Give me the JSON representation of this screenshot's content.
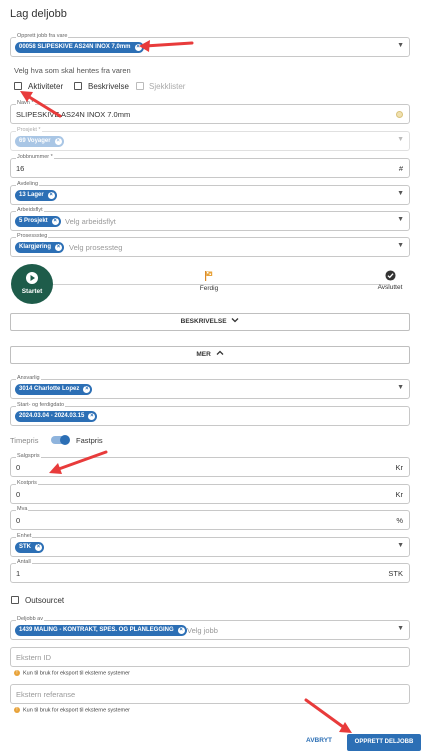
{
  "dialog": {
    "title": "Lag deljobb"
  },
  "source_product": {
    "label": "Opprett jobb fra vare",
    "chip": "00058 SLIPESKIVE AS24N INOX 7,0mm"
  },
  "fetch_section": {
    "heading": "Velg hva som skal hentes fra varen",
    "options": [
      {
        "label": "Aktiviteter",
        "enabled": true
      },
      {
        "label": "Beskrivelse",
        "enabled": true
      },
      {
        "label": "Sjekklister",
        "enabled": false
      }
    ]
  },
  "name": {
    "label": "Navn *",
    "value": "SLIPESKIVE AS24N INOX 7.0mm"
  },
  "project": {
    "label": "Prosjekt *",
    "chip": "69 Voyager"
  },
  "job_number": {
    "label": "Jobbnummer *",
    "value": "16",
    "suffix": "#"
  },
  "department": {
    "label": "Avdeling",
    "chip": "13 Lager"
  },
  "workflow": {
    "label": "Arbeidsflyt",
    "chip": "5 Prosjekt",
    "placeholder": "Velg arbeidsflyt"
  },
  "process_step": {
    "label": "Prosesssteg",
    "chip": "Klargjøring",
    "placeholder": "Velg prosessteg"
  },
  "steps": [
    {
      "label": "Startet",
      "icon": "play-icon",
      "active": true
    },
    {
      "label": "Ferdig",
      "icon": "flag-icon",
      "active": false
    },
    {
      "label": "Avsluttet",
      "icon": "check-circle-icon",
      "active": false
    }
  ],
  "description_toggle": {
    "label": "BESKRIVELSE"
  },
  "more_toggle": {
    "label": "MER"
  },
  "responsible": {
    "label": "Ansvarlig",
    "chip": "3014 Charlotte Lopez"
  },
  "dates": {
    "label": "Start- og ferdigdato",
    "chip": "2024.03.04 - 2024.03.15"
  },
  "pricing": {
    "left": "Timepris",
    "right": "Fastpris",
    "fixed": true
  },
  "sale_price": {
    "label": "Salgspris",
    "value": "0",
    "suffix": "Kr"
  },
  "cost_price": {
    "label": "Kostpris",
    "value": "0",
    "suffix": "Kr"
  },
  "vat": {
    "label": "Mva",
    "value": "0",
    "suffix": "%"
  },
  "unit": {
    "label": "Enhet",
    "chip": "STK"
  },
  "quantity": {
    "label": "Antall",
    "value": "1",
    "suffix": "STK"
  },
  "outsourced": {
    "label": "Outsourcet"
  },
  "subjob_of": {
    "label": "Deljobb av",
    "chip": "1439 MALING - KONTRAKT, SPES. OG PLANLEGGING",
    "placeholder": "Velg jobb"
  },
  "external_id": {
    "placeholder": "Ekstern ID",
    "hint": "Kun til bruk for eksport til eksterne systemer"
  },
  "external_ref": {
    "placeholder": "Ekstern referanse",
    "hint": "Kun til bruk for eksport til eksterne systemer"
  },
  "footer": {
    "cancel": "AVBRYT",
    "submit": "OPPRETT DELJOBB"
  },
  "colors": {
    "accent": "#2c6fb5",
    "stepper_active": "#1e5c4a",
    "annotation_arrow": "#e83b3b"
  }
}
